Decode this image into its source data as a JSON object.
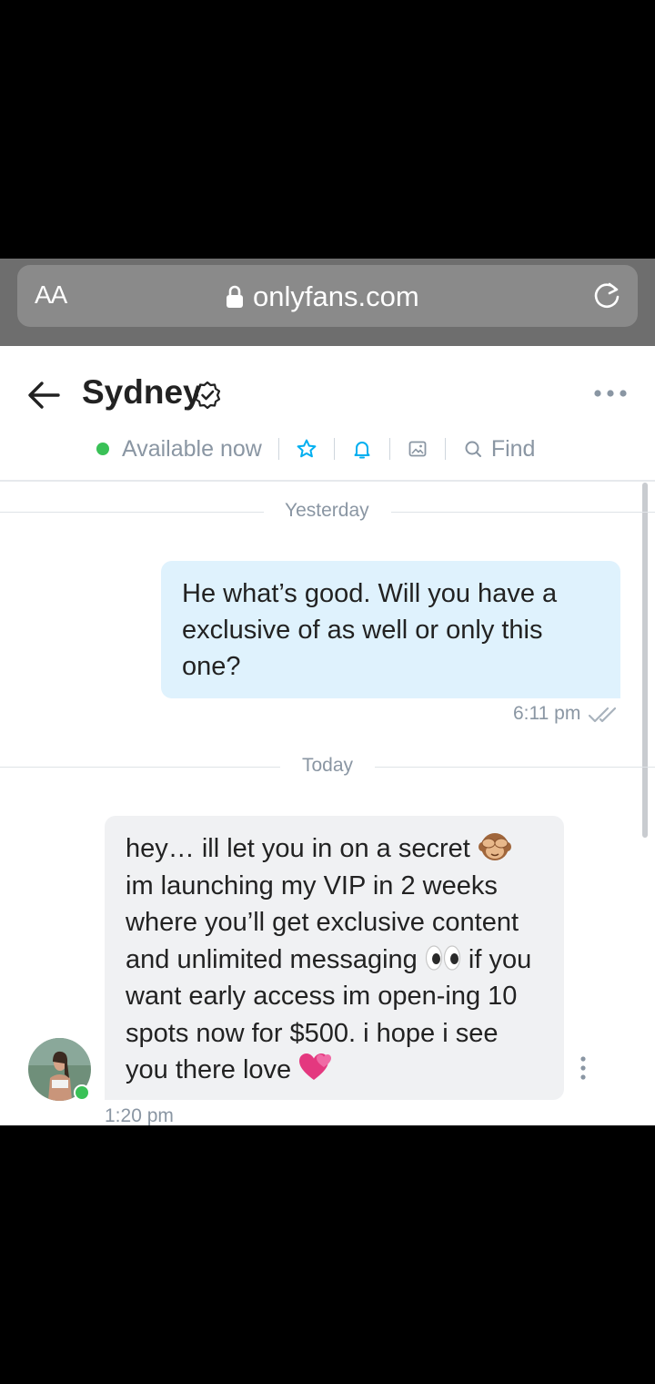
{
  "browser": {
    "aa_label": "AA",
    "url": "onlyfans.com"
  },
  "chat_header": {
    "name": "Sydney",
    "status": "Available now",
    "find_label": "Find"
  },
  "messages": [
    {
      "date_separator": "Yesterday",
      "direction": "outgoing",
      "text": "He what’s good. Will you have a exclusive of as well or only this one?",
      "time": "6:11 pm",
      "read": true
    },
    {
      "date_separator": "Today",
      "direction": "incoming",
      "text_parts": [
        "hey… ill let you in on a secret ",
        " im launching my VIP in 2 weeks where you’ll get exclusive content and unlimited messaging ",
        " if you want early access im open-ing 10 spots now for $500. i hope i see you there love "
      ],
      "emojis": [
        "see-no-evil-monkey",
        "eyes",
        "two-hearts"
      ],
      "time": "1:20 pm"
    }
  ],
  "colors": {
    "online_green": "#3ac157",
    "outgoing_bubble": "#dff2fd",
    "incoming_bubble": "#f0f1f3",
    "accent_blue": "#00aff0",
    "muted_text": "#8a96a3"
  }
}
